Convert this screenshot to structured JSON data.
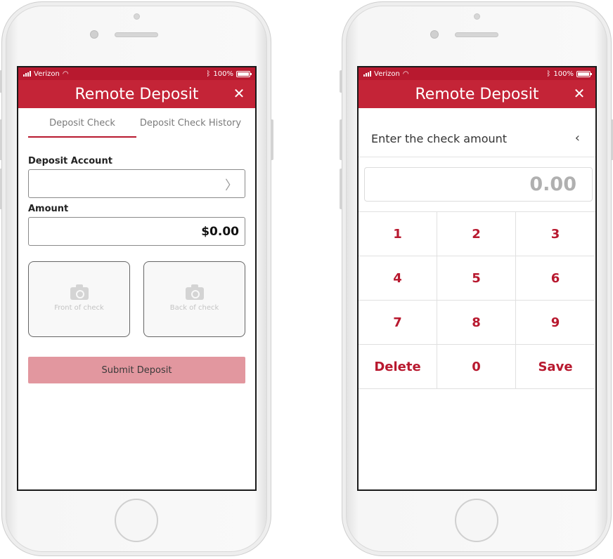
{
  "status_bar": {
    "carrier": "Verizon",
    "battery": "100%"
  },
  "title": "Remote Deposit",
  "left_screen": {
    "tabs": [
      {
        "label": "Deposit Check",
        "active": true
      },
      {
        "label": "Deposit Check History",
        "active": false
      }
    ],
    "deposit_account_label": "Deposit Account",
    "amount_label": "Amount",
    "amount_value": "$0.00",
    "front_of_check": "Front of check",
    "back_of_check": "Back of check",
    "submit_label": "Submit Deposit"
  },
  "right_screen": {
    "prompt": "Enter the check amount",
    "amount_display": "0.00",
    "keys": [
      "1",
      "2",
      "3",
      "4",
      "5",
      "6",
      "7",
      "8",
      "9",
      "Delete",
      "0",
      "Save"
    ]
  },
  "colors": {
    "brand_red": "#c42437",
    "status_red": "#b8192f",
    "submit_disabled": "#e2979f"
  },
  "icons": [
    "signal-icon",
    "wifi-icon",
    "bluetooth-icon",
    "battery-icon",
    "close-icon",
    "chevron-right-icon",
    "camera-icon",
    "chevron-left-icon"
  ]
}
